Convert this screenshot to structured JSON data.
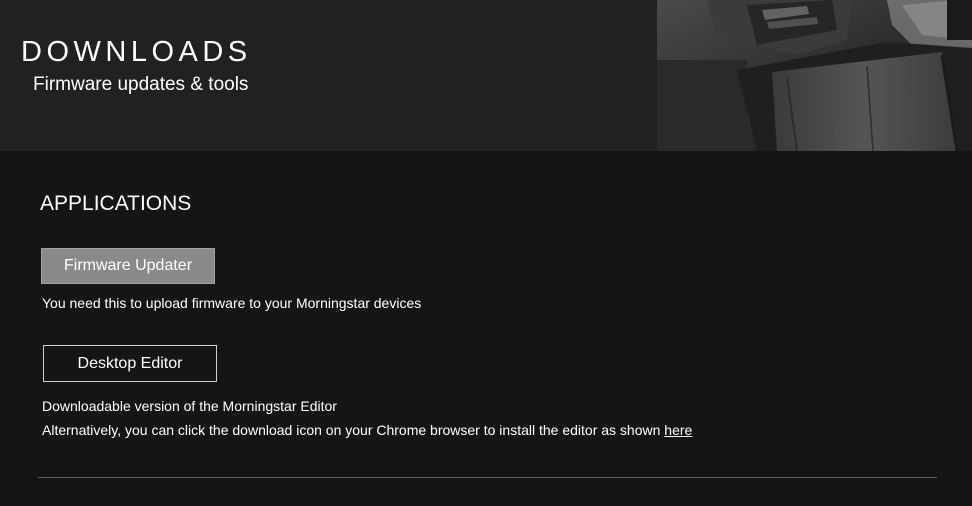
{
  "header": {
    "title": "DOWNLOADS",
    "subtitle": "Firmware updates & tools"
  },
  "applications": {
    "heading": "APPLICATIONS",
    "firmware_updater": {
      "button_label": "Firmware Updater",
      "description": "You need this to upload firmware to your Morningstar devices"
    },
    "desktop_editor": {
      "button_label": "Desktop Editor",
      "description": "Downloadable version of the Morningstar Editor",
      "alternative_text": "Alternatively, you can click the download icon on your Chrome browser to install the editor as shown ",
      "alternative_link": "here"
    }
  },
  "colors": {
    "header_bg": "#202123",
    "page_bg": "#141615",
    "updater_button_bg": "#8a8a8a",
    "text": "#ffffff"
  }
}
